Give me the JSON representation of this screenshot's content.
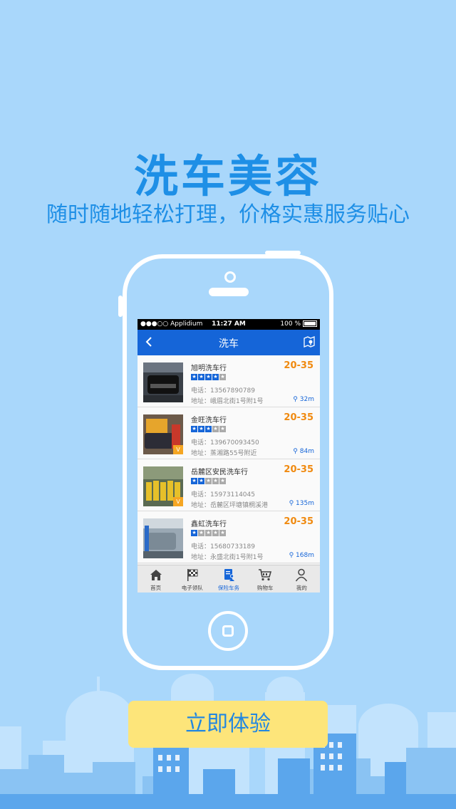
{
  "hero": {
    "title": "洗车美容",
    "subtitle": "随时随地轻松打理，价格实惠服务贴心"
  },
  "status_bar": {
    "carrier": "●●●○○ Applidium",
    "time": "11:27 AM",
    "battery": "100 %"
  },
  "nav": {
    "title": "洗车",
    "back_icon": "chevron-left-icon",
    "map_icon": "map-pin-icon"
  },
  "shops": [
    {
      "name": "旭明洗车行",
      "price": "20-35",
      "rating": 4,
      "phone": "电话：13567890789",
      "address": "地址：峨眉北街1号附1号",
      "distance": "32m",
      "badge": ""
    },
    {
      "name": "金旺洗车行",
      "price": "20-35",
      "rating": 3,
      "phone": "电话：139670093450",
      "address": "地址：蒸湘路55号附近",
      "distance": "84m",
      "badge": "V"
    },
    {
      "name": "岳麓区安民洗车行",
      "price": "20-35",
      "rating": 2,
      "phone": "电话：15973114045",
      "address": "地址：岳麓区坪塘镇桐溪港",
      "distance": "135m",
      "badge": "V"
    },
    {
      "name": "鑫虹洗车行",
      "price": "20-35",
      "rating": 1,
      "phone": "电话：15680733189",
      "address": "地址：永盛北街1号附1号",
      "distance": "168m",
      "badge": ""
    }
  ],
  "tabs": [
    {
      "label": "首页",
      "icon": "home-icon"
    },
    {
      "label": "电子领队",
      "icon": "checkered-flag-icon"
    },
    {
      "label": "保险车务",
      "icon": "document-user-icon"
    },
    {
      "label": "购物车",
      "icon": "cart-icon"
    },
    {
      "label": "我的",
      "icon": "person-icon"
    }
  ],
  "active_tab": 2,
  "cta": {
    "label": "立即体验"
  },
  "colors": {
    "background": "#a9d7fb",
    "accent_blue": "#1565d8",
    "price_orange": "#f08a10",
    "cta_yellow": "#fde57a",
    "headline_blue": "#1e8fe6"
  }
}
